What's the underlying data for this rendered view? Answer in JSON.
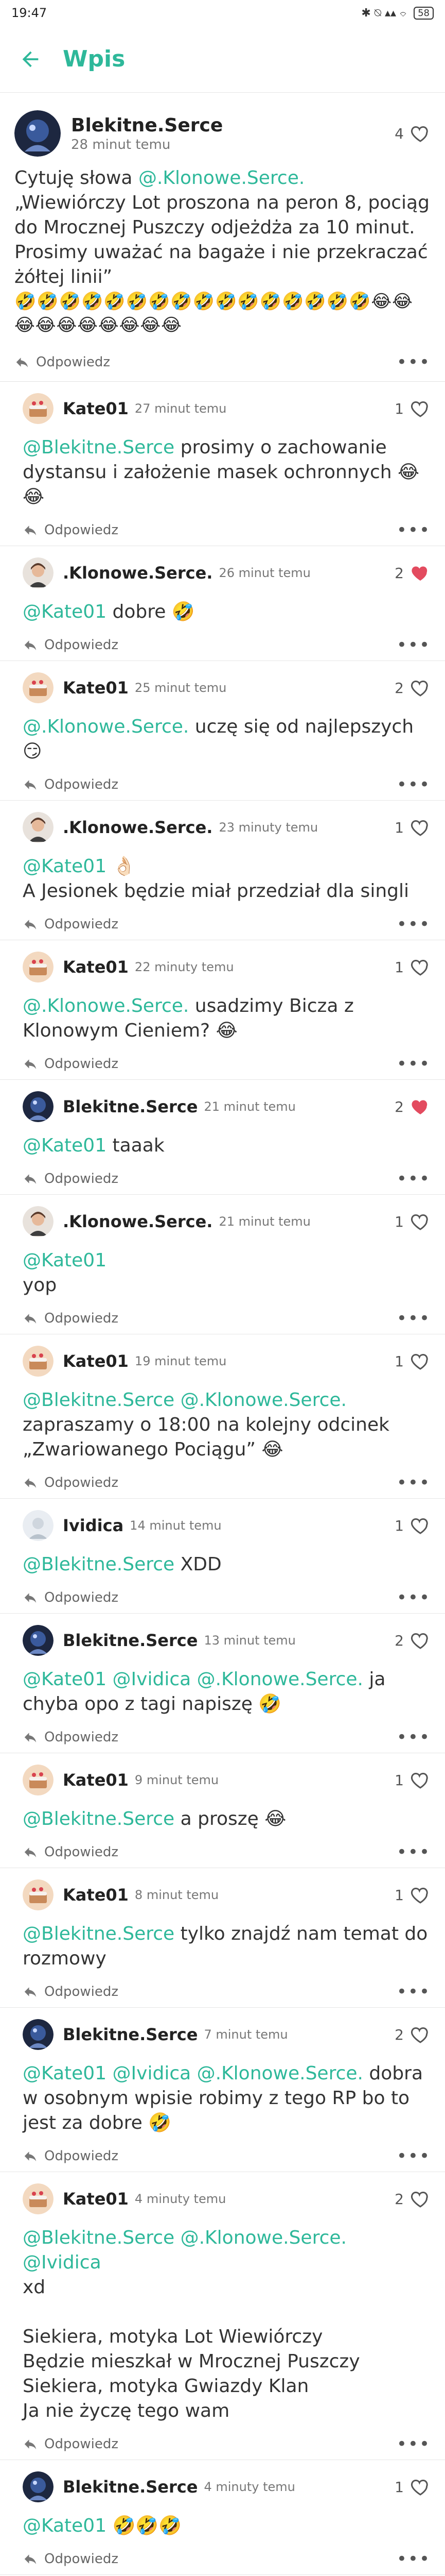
{
  "status": {
    "time": "19:47",
    "icons": "✱ ⍉ ▴▴ ⌔",
    "battery": "58"
  },
  "appbar": {
    "title": "Wpis"
  },
  "post": {
    "author": "Blekitne.Serce",
    "time": "28 minut temu",
    "likes": "4",
    "text_prefix": "Cytuję słowa ",
    "mention": "@.Klonowe.Serce.",
    "text_body": "\n„Wiewiórczy Lot proszona na peron 8, pociąg do Mrocznej Puszczy odjeżdża za 10 minut. Prosimy uważać na bagaże i nie przekraczać żółtej linii”",
    "emoji": "🤣🤣🤣🤣🤣🤣🤣🤣🤣🤣🤣🤣🤣🤣🤣🤣😂😂😂😂😂😂😂😂😂😂",
    "reply_label": "Odpowiedz"
  },
  "colors": {
    "accent": "#2eb89a",
    "heart_filled": "#e34b5f"
  },
  "comments": [
    {
      "author": "Kate01",
      "time": "27 minut temu",
      "likes": "1",
      "liked": false,
      "avatar": "cake",
      "mentions": "@Blekitne.Serce",
      "text": " prosimy o zachowanie dystansu i założenie masek ochronnych 😂😂"
    },
    {
      "author": ".Klonowe.Serce.",
      "time": "26 minut temu",
      "likes": "2",
      "liked": true,
      "avatar": "girl",
      "mentions": "@Kate01",
      "text": " dobre 🤣"
    },
    {
      "author": "Kate01",
      "time": "25 minut temu",
      "likes": "2",
      "liked": false,
      "avatar": "cake",
      "mentions": "@.Klonowe.Serce.",
      "text": " uczę się od najlepszych 😏"
    },
    {
      "author": ".Klonowe.Serce.",
      "time": "23 minuty temu",
      "likes": "1",
      "liked": false,
      "avatar": "girl",
      "mentions": "@Kate01",
      "text": " 👌🏻\nA Jesionek będzie miał przedział dla singli"
    },
    {
      "author": "Kate01",
      "time": "22 minuty temu",
      "likes": "1",
      "liked": false,
      "avatar": "cake",
      "mentions": "@.Klonowe.Serce.",
      "text": " usadzimy Bicza z Klonowym Cieniem? 😂"
    },
    {
      "author": "Blekitne.Serce",
      "time": "21 minut temu",
      "likes": "2",
      "liked": true,
      "avatar": "blue",
      "mentions": "@Kate01",
      "text": " taaak"
    },
    {
      "author": ".Klonowe.Serce.",
      "time": "21 minut temu",
      "likes": "1",
      "liked": false,
      "avatar": "girl",
      "mentions": "@Kate01",
      "text": "\nyop"
    },
    {
      "author": "Kate01",
      "time": "19 minut temu",
      "likes": "1",
      "liked": false,
      "avatar": "cake",
      "mentions": "@Blekitne.Serce @.Klonowe.Serce.",
      "text": "\nzapraszamy o 18:00 na kolejny odcinek „Zwariowanego Pociągu” 😂"
    },
    {
      "author": "Ividica",
      "time": "14 minut temu",
      "likes": "1",
      "liked": false,
      "avatar": "light",
      "mentions": "@Blekitne.Serce",
      "text": " XDD"
    },
    {
      "author": "Blekitne.Serce",
      "time": "13 minut temu",
      "likes": "2",
      "liked": false,
      "avatar": "blue",
      "mentions": "@Kate01 @Ividica @.Klonowe.Serce.",
      "text": " ja chyba opo z tagi napiszę 🤣"
    },
    {
      "author": "Kate01",
      "time": "9 minut temu",
      "likes": "1",
      "liked": false,
      "avatar": "cake",
      "mentions": "@Blekitne.Serce",
      "text": " a proszę 😂"
    },
    {
      "author": "Kate01",
      "time": "8 minut temu",
      "likes": "1",
      "liked": false,
      "avatar": "cake",
      "mentions": "@Blekitne.Serce",
      "text": " tylko znajdź nam temat do rozmowy"
    },
    {
      "author": "Blekitne.Serce",
      "time": "7 minut temu",
      "likes": "2",
      "liked": false,
      "avatar": "blue",
      "mentions": "@Kate01 @Ividica @.Klonowe.Serce.",
      "text": " dobra w osobnym wpisie robimy z tego RP bo to jest za dobre 🤣"
    },
    {
      "author": "Kate01",
      "time": "4 minuty temu",
      "likes": "2",
      "liked": false,
      "avatar": "cake",
      "mentions": "@Blekitne.Serce @.Klonowe.Serce. @Ividica",
      "text": "\nxd\n\nSiekiera, motyka Lot Wiewiórczy\nBędzie mieszkał w Mrocznej Puszczy\nSiekiera, motyka Gwiazdy Klan\nJa nie życzę tego wam"
    },
    {
      "author": "Blekitne.Serce",
      "time": "4 minuty temu",
      "likes": "1",
      "liked": false,
      "avatar": "blue",
      "mentions": "@Kate01",
      "text": " 🤣🤣🤣"
    }
  ]
}
